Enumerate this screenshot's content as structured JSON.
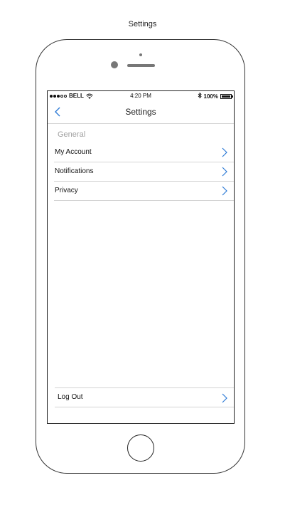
{
  "page_caption": "Settings",
  "status_bar": {
    "carrier": "BELL",
    "time": "4:20 PM",
    "battery": "100%",
    "signal_filled": 3,
    "signal_total": 5
  },
  "nav": {
    "title": "Settings",
    "back_icon": "chevron-left-icon"
  },
  "section_header": "General",
  "items": [
    {
      "label": "My Account"
    },
    {
      "label": "Notifications"
    },
    {
      "label": "Privacy"
    }
  ],
  "logout": {
    "label": "Log Out"
  },
  "colors": {
    "accent": "#2e7bd6",
    "section_header": "#a0a0a0",
    "separator": "#d4d4d4"
  }
}
